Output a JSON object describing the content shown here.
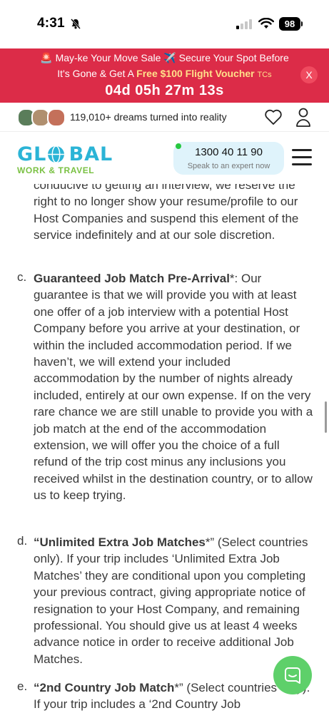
{
  "status_bar": {
    "time": "4:31",
    "battery": "98"
  },
  "promo": {
    "line1": "🚨 May-ke Your Move Sale ✈️ Secure Your Spot Before",
    "line2_prefix": "It's Gone & Get A",
    "line2_highlight": "Free $100 Flight Voucher",
    "line2_tcs": "TCs",
    "countdown": "04d 05h 27m 13s",
    "close_label": "X"
  },
  "proof": {
    "text": "119,010+ dreams turned into reality"
  },
  "header": {
    "logo_top": "GL   BAL",
    "logo_bottom": "WORK & TRAVEL",
    "phone_number": "1300 40 11 90",
    "phone_sub": "Speak to an expert now"
  },
  "content": {
    "intro_text": "conducive to getting an interview, we reserve the right to no longer show your resume/profile to our Host Companies and suspend this element of the service indefinitely and at our sole discretion.",
    "items": [
      {
        "marker": "c.",
        "bold": "Guaranteed Job Match Pre-Arrival",
        "after_bold": "*: Our guarantee is that we will provide you with at least one offer of a job interview with a potential Host Company before you arrive at your destination, or within the included accommodation period. If we haven’t, we will extend your included accommodation by the number of nights already included, entirely at our own expense. If on the very rare chance we are still unable to provide you with a job match at the end of the accommodation extension, we will offer you the choice of a full refund of the trip cost minus any inclusions you received whilst in the destination country, or to allow us to keep trying."
      },
      {
        "marker": "d.",
        "bold": "“Unlimited Extra Job Matches",
        "after_bold_star": "*”",
        "after_bold": " (Select countries only). If your trip includes ‘Unlimited Extra Job Matches’ they are conditional upon you completing your previous contract, giving appropriate notice of resignation to your Host Company, and remaining professional. You should give us at least 4 weeks advance notice in order to receive additional Job Matches."
      },
      {
        "marker": "e.",
        "bold": "“2nd Country Job Match",
        "after_bold_star": "*”",
        "after_bold": " (Select countries only). If your trip includes a ‘2nd Country Job"
      }
    ]
  },
  "colors": {
    "banner": "#dc2c48",
    "brand_blue": "#2bb4d6",
    "brand_green": "#7ac143",
    "chat": "#5ed06a"
  },
  "icons": [
    "bell-off-icon",
    "signal-icon",
    "wifi-icon",
    "heart-icon",
    "user-icon",
    "menu-icon",
    "chat-icon"
  ]
}
